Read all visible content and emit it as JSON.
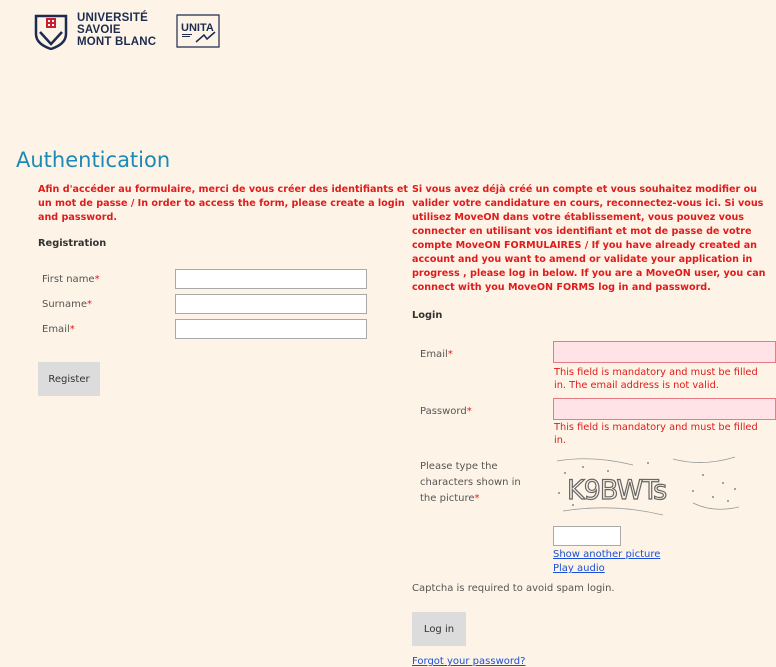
{
  "header": {
    "university_name_lines": [
      "UNIVERSITÉ",
      "SAVOIE",
      "MONT BLANC"
    ],
    "partner_logo_text": "UNITA"
  },
  "page_title": "Authentication",
  "registration": {
    "intro": "Afin d'accéder au formulaire, merci de vous créer des identifiants et un mot de passe / In order to access the form, please create a login and password.",
    "heading": "Registration",
    "fields": [
      {
        "label": "First name",
        "value": ""
      },
      {
        "label": "Surname",
        "value": ""
      },
      {
        "label": "Email",
        "value": ""
      }
    ],
    "required_mark": "*",
    "submit_label": "Register"
  },
  "login": {
    "intro": "Si vous avez déjà créé un compte et vous souhaitez modifier ou valider votre candidature en cours, reconnectez-vous ici. Si vous utilisez MoveON dans votre établissement, vous pouvez vous connecter en utilisant vos identifiant et mot de passe de votre compte MoveON FORMULAIRES / If you have already created an account and you want to amend or validate your application in progress , please log in below. If you are a MoveON user, you can connect with you MoveON FORMS log in and password.",
    "heading": "Login",
    "email_label": "Email",
    "email_error": "This field is mandatory and must be filled in. The email address is not valid.",
    "password_label": "Password",
    "password_error": "This field is mandatory and must be filled in.",
    "captcha_prompt": "Please type the characters shown in the picture",
    "captcha_text": "K9BWTs",
    "captcha_value": "",
    "show_another_picture": "Show another picture",
    "play_audio": "Play audio",
    "captcha_note": "Captcha is required to avoid spam login.",
    "submit_label": "Log in",
    "forgot_password": "Forgot your password?"
  },
  "colors": {
    "background": "#fdf4e7",
    "title": "#1a8bb6",
    "error": "#e01b1b",
    "link": "#1a4fd6"
  }
}
